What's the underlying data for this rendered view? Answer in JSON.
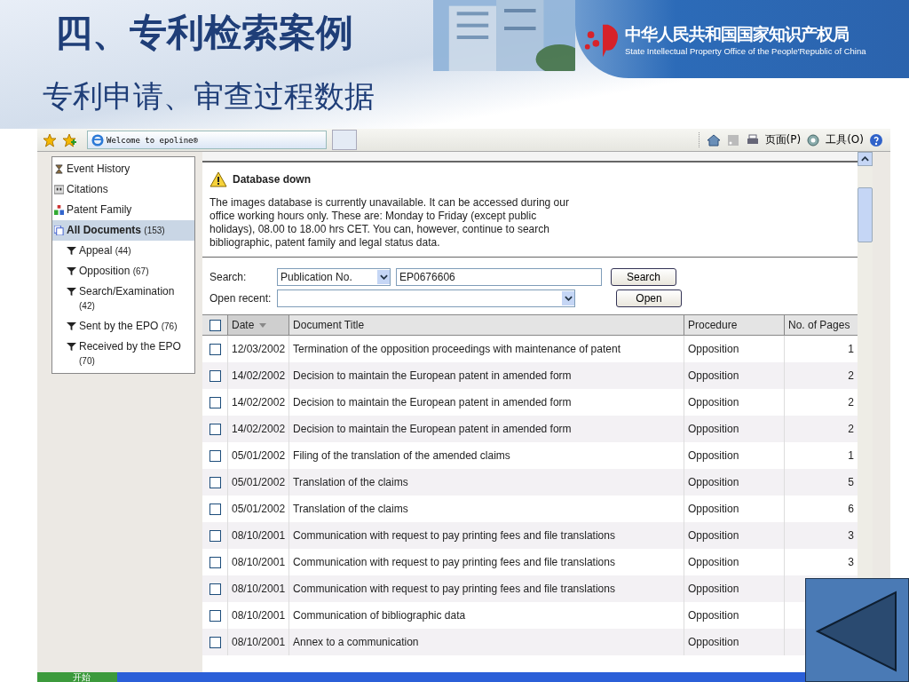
{
  "slide": {
    "title": "四、专利检索案例",
    "subtitle": "专利申请、审查过程数据",
    "logo": {
      "name": "中华人民共和国国家知识产权局",
      "english": "State Intellectual Property Office of the People'Republic of China"
    }
  },
  "browser": {
    "tab": "Welcome to epoline®",
    "page_menu": "页面(P)",
    "tools_menu": "工具(O)"
  },
  "sidebar": {
    "items": [
      {
        "label": "Event History",
        "selected": false
      },
      {
        "label": "Citations",
        "selected": false
      },
      {
        "label": "Patent Family",
        "selected": false
      },
      {
        "label": "All Documents",
        "count": "(153)",
        "selected": true,
        "children": [
          {
            "label": "Appeal",
            "count": "(44)",
            "selected": false
          },
          {
            "label": "Opposition",
            "count": "(67)",
            "selected": false
          },
          {
            "label": "Search/Examination",
            "count": "(42)",
            "selected": false
          },
          {
            "label": "Sent by the EPO",
            "count": "(76)",
            "selected": false
          },
          {
            "label": "Received by the EPO",
            "count": "(70)",
            "selected": false
          }
        ]
      }
    ]
  },
  "notice": {
    "title": "Database down",
    "text": "The images database is currently unavailable. It can be accessed during our office working hours only. These are: Monday to Friday (except public holidays), 08.00 to 18.00 hrs CET. You can, however, continue to search bibliographic, patent family and legal status data."
  },
  "search": {
    "label": "Search:",
    "type": "Publication No.",
    "value": "EP0676606",
    "button": "Search",
    "recent_label": "Open recent:",
    "open_button": "Open"
  },
  "table": {
    "header_checked": false,
    "columns": [
      {
        "label": "Date",
        "sorted": true
      },
      {
        "label": "Document Title",
        "sorted": false
      },
      {
        "label": "Procedure",
        "sorted": false
      },
      {
        "label": "No. of Pages",
        "sorted": false
      }
    ],
    "rows": [
      {
        "checked": false,
        "date": "12/03/2002",
        "title": "Termination of the opposition proceedings with maintenance of patent",
        "procedure": "Opposition",
        "pages": "1"
      },
      {
        "checked": false,
        "date": "14/02/2002",
        "title": "Decision to maintain the European patent in amended form",
        "procedure": "Opposition",
        "pages": "2"
      },
      {
        "checked": false,
        "date": "14/02/2002",
        "title": "Decision to maintain the European patent in amended form",
        "procedure": "Opposition",
        "pages": "2"
      },
      {
        "checked": false,
        "date": "14/02/2002",
        "title": "Decision to maintain the European patent in amended form",
        "procedure": "Opposition",
        "pages": "2"
      },
      {
        "checked": false,
        "date": "05/01/2002",
        "title": "Filing of the translation of the amended claims",
        "procedure": "Opposition",
        "pages": "1"
      },
      {
        "checked": false,
        "date": "05/01/2002",
        "title": "Translation of the claims",
        "procedure": "Opposition",
        "pages": "5"
      },
      {
        "checked": false,
        "date": "05/01/2002",
        "title": "Translation of the claims",
        "procedure": "Opposition",
        "pages": "6"
      },
      {
        "checked": false,
        "date": "08/10/2001",
        "title": "Communication with request to pay printing fees and file translations",
        "procedure": "Opposition",
        "pages": "3"
      },
      {
        "checked": false,
        "date": "08/10/2001",
        "title": "Communication with request to pay printing fees and file translations",
        "procedure": "Opposition",
        "pages": "3"
      },
      {
        "checked": false,
        "date": "08/10/2001",
        "title": "Communication with request to pay printing fees and file translations",
        "procedure": "Opposition"
      },
      {
        "checked": false,
        "date": "08/10/2001",
        "title": "Communication of bibliographic data",
        "procedure": "Opposition"
      },
      {
        "checked": false,
        "date": "08/10/2001",
        "title": "Annex to a communication",
        "procedure": "Opposition"
      }
    ]
  },
  "taskbar": {
    "start": "开始"
  }
}
